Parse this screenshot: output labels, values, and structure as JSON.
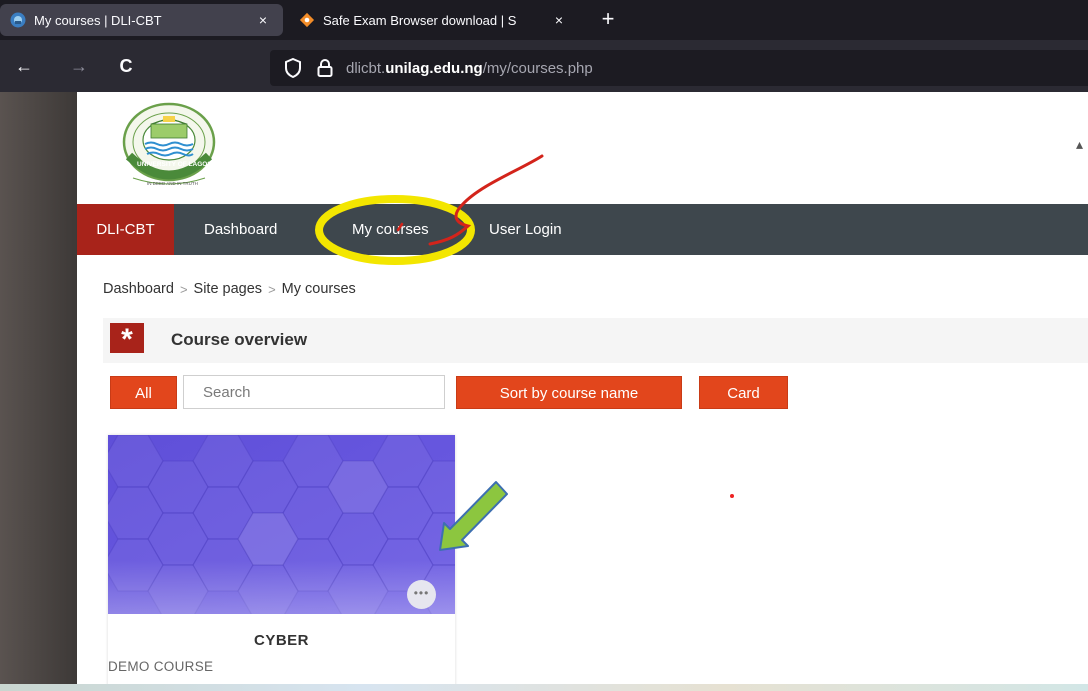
{
  "browser": {
    "tabs": [
      {
        "title": "My courses | DLI-CBT",
        "close": "×",
        "active": true
      },
      {
        "title": "Safe Exam Browser download | S",
        "close": "×",
        "active": false
      }
    ],
    "new_tab_glyph": "+",
    "back_glyph": "←",
    "forward_glyph": "→",
    "reload_glyph": "C",
    "url": {
      "prefix": "dlicbt.",
      "domain": "unilag.edu.ng",
      "path": "/my/courses.php"
    }
  },
  "site": {
    "logo_text": {
      "top": "UNIVERSITY OF LAGOS",
      "motto": "IN DEED AND IN TRUTH"
    },
    "menu": {
      "brand": "DLI-CBT",
      "items": [
        "Dashboard",
        "My courses",
        "User Login"
      ]
    },
    "breadcrumb": [
      "Dashboard",
      "Site pages",
      "My courses"
    ],
    "breadcrumb_sep": ">",
    "overview": {
      "title": "Course overview",
      "icon_glyph": "*",
      "filter_all": "All",
      "search_placeholder": "Search",
      "sort_label": "Sort by course name",
      "view_label": "Card"
    },
    "courses": [
      {
        "name": "CYBER",
        "category": "DEMO COURSE",
        "more_glyph": "•••"
      }
    ]
  },
  "colors": {
    "brand_red": "#a8231a",
    "action_orange": "#e2461c",
    "menu_bar": "#3e474d",
    "card_purple": "#6a5ae0",
    "highlight_yellow": "#f3e600",
    "annotation_green": "#8cc63f"
  }
}
